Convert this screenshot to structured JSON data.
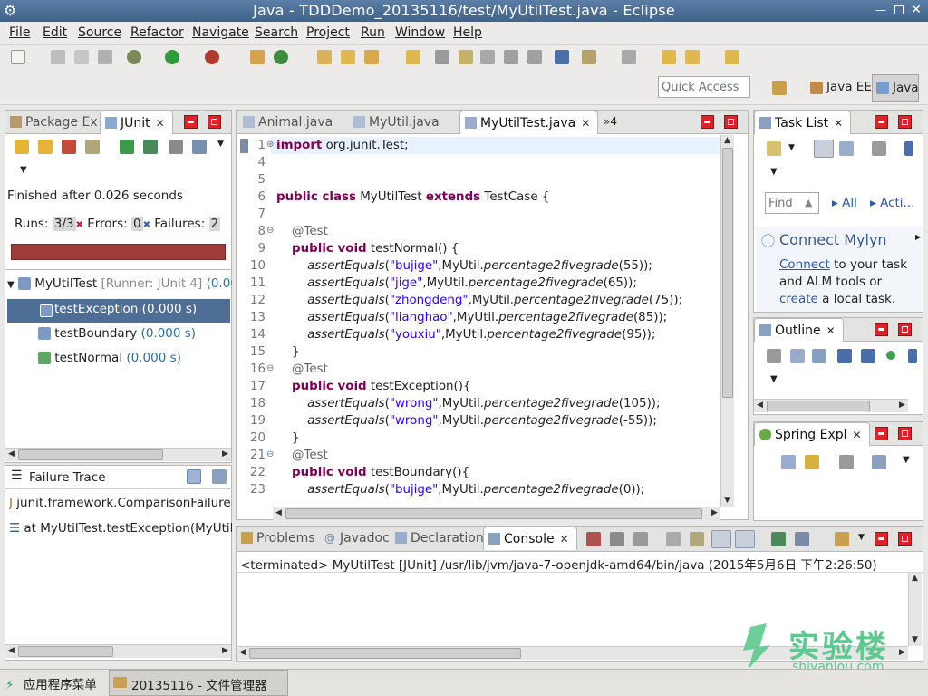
{
  "window": {
    "title": "Java - TDDDemo_20135116/test/MyUtilTest.java - Eclipse"
  },
  "menu": [
    "File",
    "Edit",
    "Source",
    "Refactor",
    "Navigate",
    "Search",
    "Project",
    "Run",
    "Window",
    "Help"
  ],
  "quick_access": {
    "placeholder": "Quick Access"
  },
  "perspectives": {
    "java_ee": "Java EE",
    "java": "Java"
  },
  "left": {
    "tabs": {
      "package_explorer": "Package Ex",
      "junit": "JUnit"
    },
    "finished": "Finished after 0.026 seconds",
    "runs_label": "Runs:",
    "runs_value": "3/3",
    "errors_label": "Errors:",
    "errors_value": "0",
    "failures_label": "Failures:",
    "failures_value": "2",
    "tree_root": "MyUtilTest",
    "tree_root_runner": "[Runner: JUnit 4]",
    "tree_root_time": "(0.00",
    "tests": [
      {
        "name": "testException",
        "time": "(0.000 s)"
      },
      {
        "name": "testBoundary",
        "time": "(0.000 s)"
      },
      {
        "name": "testNormal",
        "time": "(0.000 s)"
      }
    ],
    "failure_trace_title": "Failure Trace",
    "trace": [
      "junit.framework.ComparisonFailure",
      "at MyUtilTest.testException(MyUtil"
    ]
  },
  "editor": {
    "tabs": [
      {
        "label": "Animal.java"
      },
      {
        "label": "MyUtil.java"
      },
      {
        "label": "MyUtilTest.java"
      }
    ],
    "overflow": "»4",
    "lines": [
      {
        "n": "1",
        "segs": [
          {
            "t": "import",
            "c": "kw"
          },
          {
            "t": " org.junit.Test;",
            "c": ""
          }
        ]
      },
      {
        "n": "4",
        "segs": []
      },
      {
        "n": "5",
        "segs": []
      },
      {
        "n": "6",
        "segs": [
          {
            "t": "public class",
            "c": "kw"
          },
          {
            "t": " MyUtilTest ",
            "c": ""
          },
          {
            "t": "extends",
            "c": "kw"
          },
          {
            "t": " TestCase {",
            "c": ""
          }
        ]
      },
      {
        "n": "7",
        "segs": []
      },
      {
        "n": "8",
        "segs": [
          {
            "t": "    @Test",
            "c": "ann"
          }
        ]
      },
      {
        "n": "9",
        "segs": [
          {
            "t": "    ",
            "c": ""
          },
          {
            "t": "public void",
            "c": "kw"
          },
          {
            "t": " testNormal() {",
            "c": ""
          }
        ]
      },
      {
        "n": "10",
        "segs": [
          {
            "t": "        ",
            "c": ""
          },
          {
            "t": "assertEquals",
            "c": "it"
          },
          {
            "t": "(",
            "c": ""
          },
          {
            "t": "\"bujige\"",
            "c": "str"
          },
          {
            "t": ",MyUtil.",
            "c": ""
          },
          {
            "t": "percentage2fivegrade",
            "c": "it"
          },
          {
            "t": "(55));",
            "c": ""
          }
        ]
      },
      {
        "n": "11",
        "segs": [
          {
            "t": "        ",
            "c": ""
          },
          {
            "t": "assertEquals",
            "c": "it"
          },
          {
            "t": "(",
            "c": ""
          },
          {
            "t": "\"jige\"",
            "c": "str"
          },
          {
            "t": ",MyUtil.",
            "c": ""
          },
          {
            "t": "percentage2fivegrade",
            "c": "it"
          },
          {
            "t": "(65));",
            "c": ""
          }
        ]
      },
      {
        "n": "12",
        "segs": [
          {
            "t": "        ",
            "c": ""
          },
          {
            "t": "assertEquals",
            "c": "it"
          },
          {
            "t": "(",
            "c": ""
          },
          {
            "t": "\"zhongdeng\"",
            "c": "str"
          },
          {
            "t": ",MyUtil.",
            "c": ""
          },
          {
            "t": "percentage2fivegrade",
            "c": "it"
          },
          {
            "t": "(75));",
            "c": ""
          }
        ]
      },
      {
        "n": "13",
        "segs": [
          {
            "t": "        ",
            "c": ""
          },
          {
            "t": "assertEquals",
            "c": "it"
          },
          {
            "t": "(",
            "c": ""
          },
          {
            "t": "\"lianghao\"",
            "c": "str"
          },
          {
            "t": ",MyUtil.",
            "c": ""
          },
          {
            "t": "percentage2fivegrade",
            "c": "it"
          },
          {
            "t": "(85));",
            "c": ""
          }
        ]
      },
      {
        "n": "14",
        "segs": [
          {
            "t": "        ",
            "c": ""
          },
          {
            "t": "assertEquals",
            "c": "it"
          },
          {
            "t": "(",
            "c": ""
          },
          {
            "t": "\"youxiu\"",
            "c": "str"
          },
          {
            "t": ",MyUtil.",
            "c": ""
          },
          {
            "t": "percentage2fivegrade",
            "c": "it"
          },
          {
            "t": "(95));",
            "c": ""
          }
        ]
      },
      {
        "n": "15",
        "segs": [
          {
            "t": "    }",
            "c": ""
          }
        ]
      },
      {
        "n": "16",
        "segs": [
          {
            "t": "    @Test",
            "c": "ann"
          }
        ]
      },
      {
        "n": "17",
        "segs": [
          {
            "t": "    ",
            "c": ""
          },
          {
            "t": "public void",
            "c": "kw"
          },
          {
            "t": " testException(){",
            "c": ""
          }
        ]
      },
      {
        "n": "18",
        "segs": [
          {
            "t": "        ",
            "c": ""
          },
          {
            "t": "assertEquals",
            "c": "it"
          },
          {
            "t": "(",
            "c": ""
          },
          {
            "t": "\"wrong\"",
            "c": "str"
          },
          {
            "t": ",MyUtil.",
            "c": ""
          },
          {
            "t": "percentage2fivegrade",
            "c": "it"
          },
          {
            "t": "(105));",
            "c": ""
          }
        ]
      },
      {
        "n": "19",
        "segs": [
          {
            "t": "        ",
            "c": ""
          },
          {
            "t": "assertEquals",
            "c": "it"
          },
          {
            "t": "(",
            "c": ""
          },
          {
            "t": "\"wrong\"",
            "c": "str"
          },
          {
            "t": ",MyUtil.",
            "c": ""
          },
          {
            "t": "percentage2fivegrade",
            "c": "it"
          },
          {
            "t": "(-55));",
            "c": ""
          }
        ]
      },
      {
        "n": "20",
        "segs": [
          {
            "t": "    }",
            "c": ""
          }
        ]
      },
      {
        "n": "21",
        "segs": [
          {
            "t": "    @Test",
            "c": "ann"
          }
        ]
      },
      {
        "n": "22",
        "segs": [
          {
            "t": "    ",
            "c": ""
          },
          {
            "t": "public void",
            "c": "kw"
          },
          {
            "t": " testBoundary(){",
            "c": ""
          }
        ]
      },
      {
        "n": "23",
        "segs": [
          {
            "t": "        ",
            "c": ""
          },
          {
            "t": "assertEquals",
            "c": "it"
          },
          {
            "t": "(",
            "c": ""
          },
          {
            "t": "\"bujige\"",
            "c": "str"
          },
          {
            "t": ",MyUtil.",
            "c": ""
          },
          {
            "t": "percentage2fivegrade",
            "c": "it"
          },
          {
            "t": "(0));",
            "c": ""
          }
        ]
      }
    ]
  },
  "right": {
    "task_list": "Task List",
    "find_placeholder": "Find",
    "all": "All",
    "acti": "Acti...",
    "connect_mylyn_title": "Connect Mylyn",
    "mylyn_connect": "Connect",
    "mylyn_mid": " to your task and ALM tools or ",
    "mylyn_create": "create",
    "mylyn_end": " a local task.",
    "outline": "Outline",
    "spring": "Spring Expl"
  },
  "bottom": {
    "tabs": [
      "Problems",
      "Javadoc",
      "Declaration",
      "Console"
    ],
    "console_text": "<terminated> MyUtilTest [JUnit] /usr/lib/jvm/java-7-openjdk-amd64/bin/java (2015年5月6日 下午2:26:50)"
  },
  "watermark": {
    "cn": "实验楼",
    "en": "shiyanlou.com"
  },
  "taskbar": {
    "start": "应用程序菜单",
    "window": "20135116 - 文件管理器"
  }
}
